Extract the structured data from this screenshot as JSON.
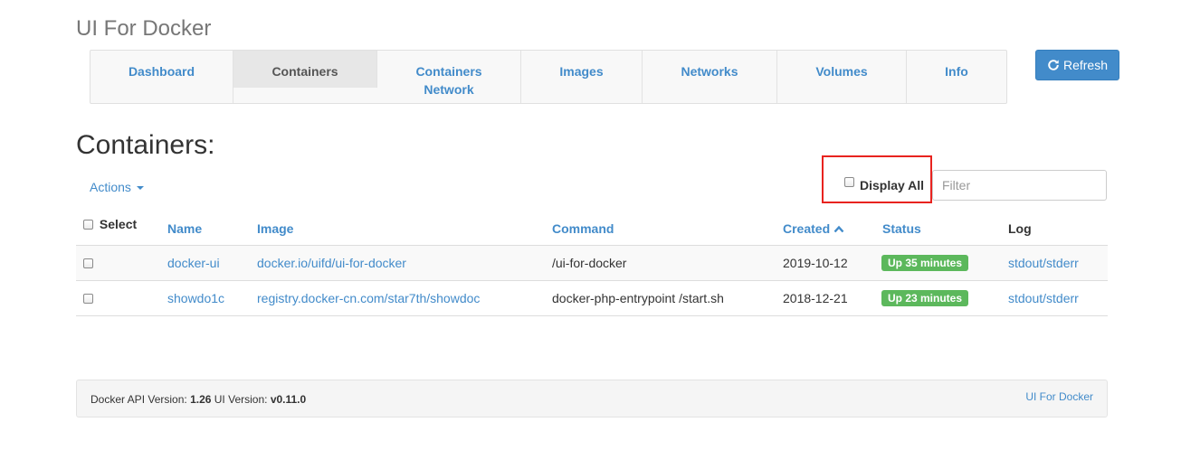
{
  "app": {
    "title": "UI For Docker"
  },
  "nav": {
    "items": [
      {
        "label": "Dashboard"
      },
      {
        "label": "Containers"
      },
      {
        "label": "Containers Network"
      },
      {
        "label": "Images"
      },
      {
        "label": "Networks"
      },
      {
        "label": "Volumes"
      },
      {
        "label": "Info"
      }
    ],
    "active": "Containers"
  },
  "toolbar": {
    "refresh_label": "Refresh"
  },
  "page": {
    "title": "Containers:"
  },
  "controls": {
    "actions_label": "Actions",
    "display_all_label": "Display All",
    "filter_placeholder": "Filter"
  },
  "table": {
    "headers": {
      "select": "Select",
      "name": "Name",
      "image": "Image",
      "command": "Command",
      "created": "Created",
      "status": "Status",
      "log": "Log"
    },
    "rows": [
      {
        "name": "docker-ui",
        "image": "docker.io/uifd/ui-for-docker",
        "command": "/ui-for-docker",
        "created": "2019-10-12",
        "status": "Up 35 minutes",
        "log": "stdout/stderr"
      },
      {
        "name": "showdo1c",
        "image": "registry.docker-cn.com/star7th/showdoc",
        "command": "docker-php-entrypoint /start.sh",
        "created": "2018-12-21",
        "status": "Up 23 minutes",
        "log": "stdout/stderr"
      }
    ]
  },
  "footer": {
    "api_label": "Docker API Version:",
    "api_version": "1.26",
    "ui_label": "UI Version:",
    "ui_version": "v0.11.0",
    "link": "UI For Docker"
  },
  "colors": {
    "primary": "#428bca",
    "success": "#5cb85c",
    "highlight": "#e8231f"
  },
  "icons": {
    "refresh": "refresh-icon",
    "sort": "sort-ascending-icon",
    "caret": "caret-down-icon"
  }
}
